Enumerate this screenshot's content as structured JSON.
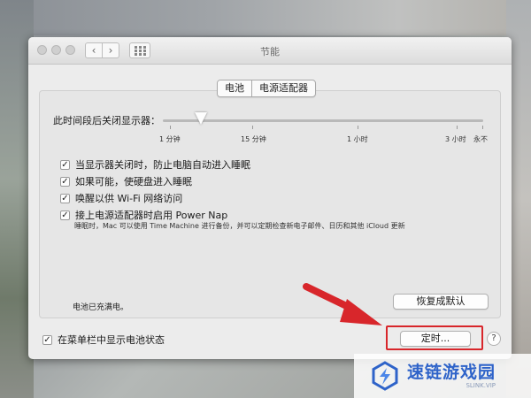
{
  "window": {
    "title": "节能"
  },
  "tabs": [
    {
      "label": "电池",
      "active": true
    },
    {
      "label": "电源适配器",
      "active": false
    }
  ],
  "display_sleep": {
    "label": "此时间段后关闭显示器：",
    "ticks": [
      "1 分钟",
      "15 分钟",
      "1 小时",
      "3 小时",
      "永不"
    ],
    "level_fraction": 0.12
  },
  "options": [
    {
      "label": "当显示器关闭时，防止电脑自动进入睡眠",
      "checked": true
    },
    {
      "label": "如果可能，使硬盘进入睡眠",
      "checked": true
    },
    {
      "label": "唤醒以供 Wi-Fi 网络访问",
      "checked": true
    },
    {
      "label": "接上电源适配器时启用 Power Nap",
      "checked": true
    }
  ],
  "power_nap_desc": "睡眠时，Mac 可以使用 Time Machine 进行备份，并可以定期检查新电子邮件、日历和其他 iCloud 更新",
  "battery_status": "电池已充满电。",
  "buttons": {
    "restore_defaults": "恢复成默认",
    "schedule": "定时..."
  },
  "menu_bar_option": {
    "label": "在菜单栏中显示电池状态",
    "checked": true
  },
  "help_label": "?",
  "watermark": {
    "main": "速链游戏园",
    "sub": "SLINK.VIP"
  },
  "colors": {
    "highlight": "#d8262b",
    "arrow": "#d8262b",
    "watermark_blue": "#2e63c9"
  }
}
